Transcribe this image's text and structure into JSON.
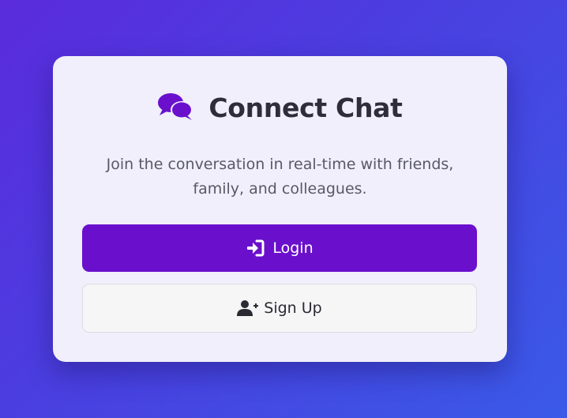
{
  "app": {
    "title": "Connect Chat",
    "subtitle": "Join the conversation in real-time with friends, family, and colleagues.",
    "logo_icon": "chat-bubbles-icon",
    "accent_color": "#6a10cc"
  },
  "actions": {
    "login_label": "Login",
    "login_icon": "sign-in-icon",
    "signup_label": "Sign Up",
    "signup_icon": "user-plus-icon"
  }
}
